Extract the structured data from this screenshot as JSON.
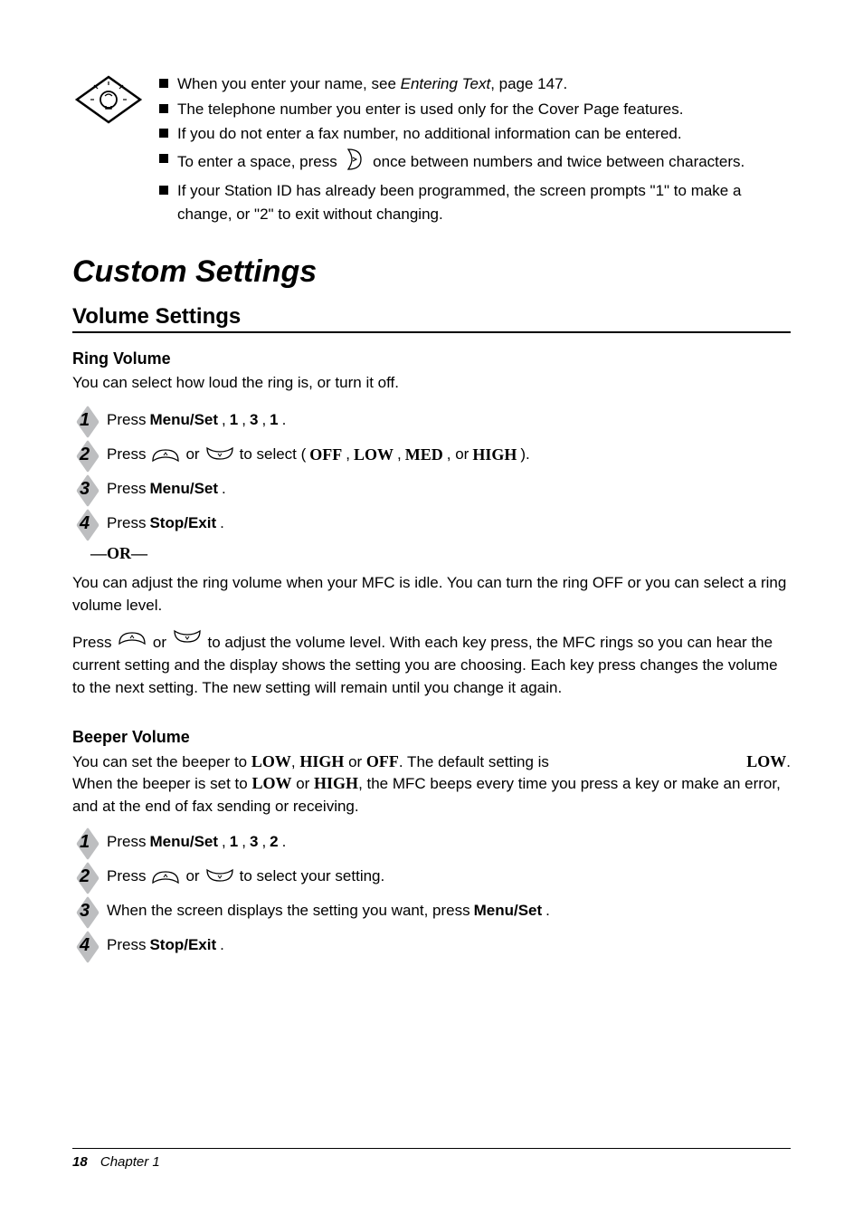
{
  "tip": {
    "b1a": "When you enter your name, see ",
    "b1_link": "Entering Text",
    "b1b": ", page 147.",
    "b2": "The telephone number you enter is used only for the Cover Page features.",
    "b3": "If you do not enter a fax number, no additional information can be entered.",
    "b4a": "To enter a space, press ",
    "b4b": " once between numbers and twice between characters.",
    "b5": "If your Station ID has already been programmed, the screen prompts \"1\" to make a change, or \"2\" to exit without changing."
  },
  "section_title": "Custom Settings",
  "volume": {
    "title": "Volume Settings",
    "ring": {
      "title": "Ring Volume",
      "intro": "You can select how loud the ring is, or turn it off.",
      "s1a": "Press ",
      "s1b": "Menu/Set",
      "s1c": ", ",
      "s1d": "1",
      "s1e": ", ",
      "s1f": "3",
      "s1g": ", ",
      "s1h": "1",
      "s1i": ".",
      "s2a": "Press ",
      "s2b": " or ",
      "s2c": " to select (",
      "s2d": "OFF",
      "s2e": ", ",
      "s2f": "LOW",
      "s2g": ", ",
      "s2h": "MED",
      "s2i": ", or ",
      "s2j": "HIGH",
      "s2k": ").",
      "s3a": "Press ",
      "s3b": "Menu/Set",
      "s3c": ".",
      "s4a": "Press ",
      "s4b": "Stop/Exit",
      "s4c": ".",
      "or": "—OR—",
      "post_a": "You can adjust the ring volume when your MFC is idle. You can turn the ring OFF or you can select a ring volume level.",
      "post_b1": "Press ",
      "post_b2": " or ",
      "post_b3": " to adjust the volume level. With each key press, the MFC rings so you can hear the current setting and the display shows the setting you are choosing. Each key press changes the volume to the next setting. The new setting will remain until you change it again."
    },
    "beeper": {
      "title": "Beeper Volume",
      "line1a": "You can set the beeper to ",
      "line1b": "LOW",
      "line1c": ", ",
      "line1d": "HIGH",
      "line1e": " or ",
      "line1f": "OFF",
      "line1g": ". The default setting is ",
      "line1h": "LOW",
      "line1i": ".",
      "line2a": "When the beeper is set to ",
      "line2b": "LOW",
      "line2c": " or ",
      "line2d": "HIGH",
      "line2e": ", the MFC beeps every time you press a key or make an error, and at the end of fax sending or receiving.",
      "s1a": "Press ",
      "s1b": "Menu/Set",
      "s1c": ", ",
      "s1d": "1",
      "s1e": ", ",
      "s1f": "3",
      "s1g": ", ",
      "s1h": "2",
      "s1i": ".",
      "s2a": "Press ",
      "s2b": " or ",
      "s2c": " to select your setting.",
      "s3a": "When the screen displays the setting you want, press ",
      "s3b": "Menu/Set",
      "s3c": ".",
      "s4a": "Press ",
      "s4b": "Stop/Exit",
      "s4c": "."
    }
  },
  "footer": {
    "page": "18",
    "chapter": "Chapter 1"
  }
}
